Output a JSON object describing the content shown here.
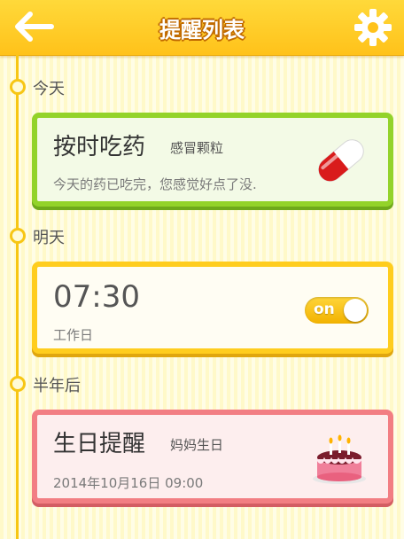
{
  "header": {
    "title": "提醒列表"
  },
  "timeline": [
    {
      "date_label": "今天",
      "card": {
        "title": "按时吃药",
        "subtitle": "感冒颗粒",
        "description": "今天的药已吃完，您感觉好点了没.",
        "icon": "pill-icon",
        "theme_color": "#93d32a"
      }
    },
    {
      "date_label": "明天",
      "card": {
        "time": "07:30",
        "description": "工作日",
        "toggle_label": "on",
        "toggle_state": true,
        "theme_color": "#ffcd1e"
      }
    },
    {
      "date_label": "半年后",
      "card": {
        "title": "生日提醒",
        "subtitle": "妈妈生日",
        "description": "2014年10月16日  09:00",
        "icon": "cake-icon",
        "theme_color": "#f27e83"
      }
    }
  ],
  "colors": {
    "header": "#ffc21a",
    "timeline": "#f7c615"
  }
}
